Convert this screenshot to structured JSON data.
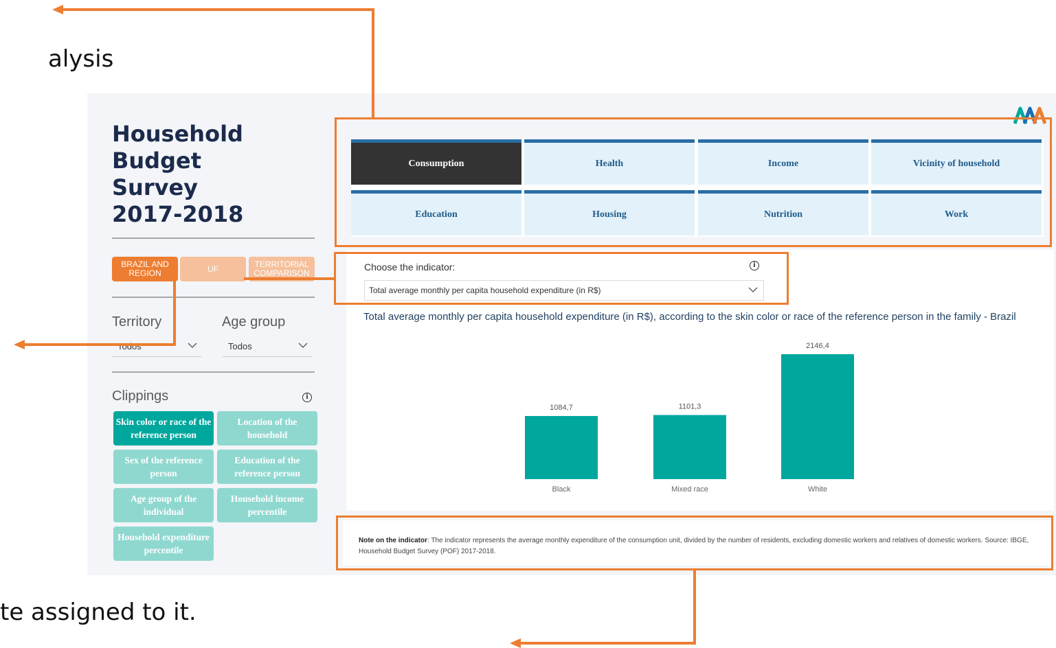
{
  "slide": {
    "fragment_top": "alysis",
    "fragment_bottom": "te assigned to it."
  },
  "sidebar": {
    "title": "Household\nBudget\nSurvey\n2017-2018",
    "geo_tabs": [
      {
        "label": "BRAZIL AND REGION",
        "active": true
      },
      {
        "label": "UF",
        "active": false
      },
      {
        "label": "TERRITORIAL COMPARISON",
        "active": false
      }
    ],
    "territory_label": "Territory",
    "territory_value": "Todos",
    "age_label": "Age group",
    "age_value": "Todos",
    "clippings_label": "Clippings",
    "clippings": [
      {
        "label": "Skin color or race of the reference person",
        "active": true
      },
      {
        "label": "Location of the household",
        "active": false
      },
      {
        "label": "Sex of the reference person",
        "active": false
      },
      {
        "label": "Education of the reference person",
        "active": false
      },
      {
        "label": "Age group of the individual",
        "active": false
      },
      {
        "label": "Household income percentile",
        "active": false
      },
      {
        "label": "Household expenditure percentile",
        "active": false
      }
    ]
  },
  "tabs": [
    {
      "label": "Consumption",
      "active": true
    },
    {
      "label": "Health",
      "active": false
    },
    {
      "label": "Income",
      "active": false
    },
    {
      "label": "Vicinity of household",
      "active": false
    },
    {
      "label": "Education",
      "active": false
    },
    {
      "label": "Housing",
      "active": false
    },
    {
      "label": "Nutrition",
      "active": false
    },
    {
      "label": "Work",
      "active": false
    }
  ],
  "indicator": {
    "label": "Choose the indicator:",
    "value": "Total average monthly per capita household expenditure (in R$)"
  },
  "chart_title": "Total average monthly per capita household expenditure (in R$), according to the skin color or race of the reference person in the family - Brazil",
  "chart_data": {
    "type": "bar",
    "categories": [
      "Black",
      "Mixed race",
      "White"
    ],
    "values": [
      1084.7,
      1101.3,
      2146.4
    ],
    "value_labels": [
      "1084,7",
      "1101,3",
      "2146,4"
    ],
    "ylim": [
      0,
      2300
    ],
    "color": "#00a79d"
  },
  "note": {
    "bold": "Note on the indicator",
    "text": ": The indicator represents the average monthly expenditure of the consumption unit, divided by the number of residents, excluding domestic workers and relatives of domestic workers. Source: IBGE, Household Budget Survey (POF) 2017-2018."
  },
  "colors": {
    "accent_orange": "#ed7d31",
    "teal": "#00a79d",
    "teal_light": "#8fd8d0",
    "navy": "#1c2b4c",
    "tab_blue": "#2a6ea5"
  },
  "icons": {
    "info": "info-icon",
    "chevron": "chevron-down-icon",
    "logo": "brand-logo"
  }
}
